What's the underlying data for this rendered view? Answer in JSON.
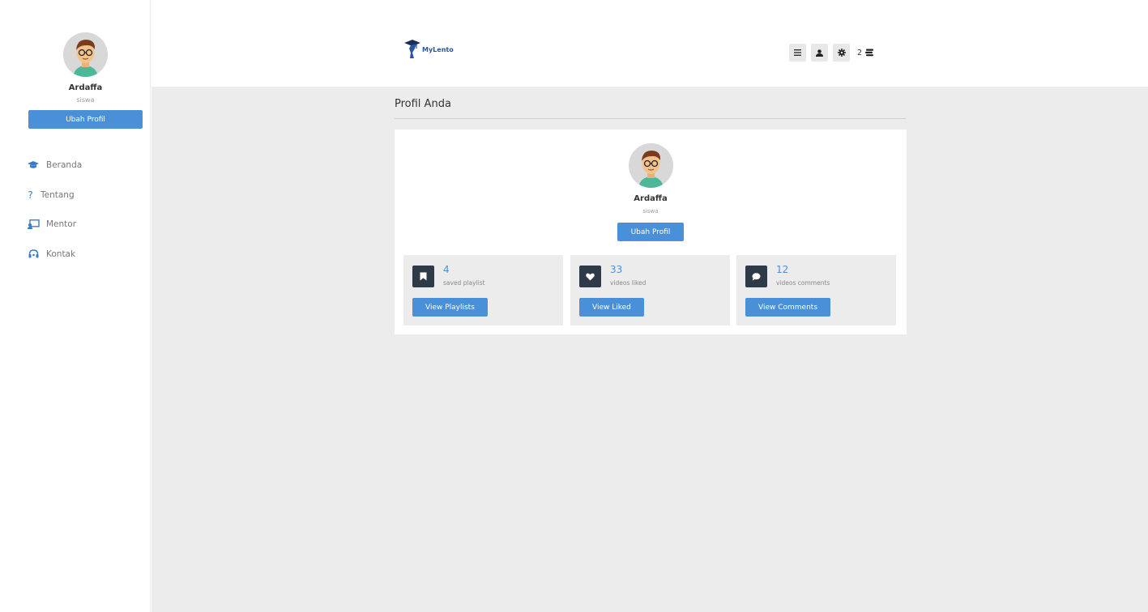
{
  "sidebar": {
    "user": {
      "name": "Ardaffa",
      "role": "siswa"
    },
    "edit_button": "Ubah Profil",
    "nav": [
      {
        "icon": "graduation-cap-icon",
        "label": "Beranda"
      },
      {
        "icon": "question-icon",
        "label": "Tentang"
      },
      {
        "icon": "chalkboard-teacher-icon",
        "label": "Mentor"
      },
      {
        "icon": "headset-icon",
        "label": "Kontak"
      }
    ]
  },
  "header": {
    "logo_text": "MyLento",
    "icons": [
      "menu-icon",
      "user-icon",
      "gear-icon"
    ],
    "count": "2"
  },
  "main": {
    "title": "Profil Anda",
    "profile": {
      "name": "Ardaffa",
      "role": "siswa",
      "edit_button": "Ubah Profil"
    },
    "stats": [
      {
        "icon": "bookmark-icon",
        "value": "4",
        "label": "saved playlist",
        "button": "View Playlists"
      },
      {
        "icon": "heart-icon",
        "value": "33",
        "label": "videos liked",
        "button": "View Liked"
      },
      {
        "icon": "comment-icon",
        "value": "12",
        "label": "videos comments",
        "button": "View Comments"
      }
    ]
  },
  "colors": {
    "accent": "#4a90d9",
    "icon_bg": "#2f3a48",
    "page_bg": "#ececec"
  }
}
